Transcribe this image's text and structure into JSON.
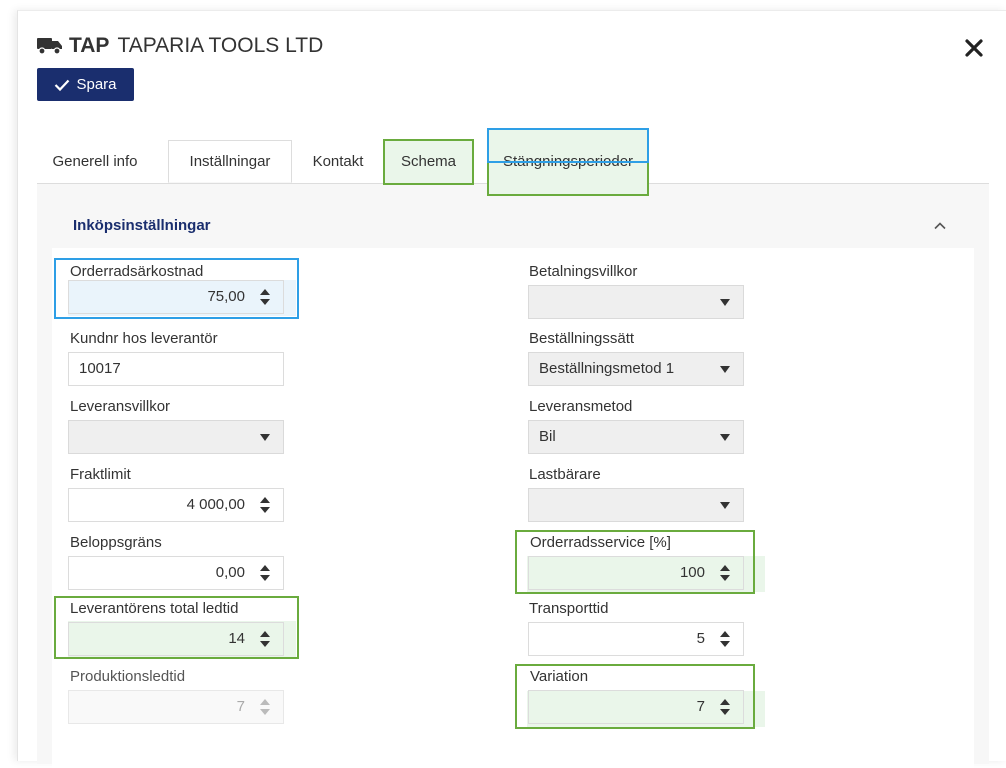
{
  "header": {
    "code": "TAP",
    "name": "TAPARIA TOOLS LTD",
    "save_label": "Spara",
    "truck_icon": "truck-icon",
    "close_icon": "close-icon"
  },
  "tabs": [
    {
      "label": "Generell info"
    },
    {
      "label": "Inställningar"
    },
    {
      "label": "Kontakt"
    },
    {
      "label": "Schema"
    },
    {
      "label": "Stängningsperioder"
    }
  ],
  "section": {
    "title": "Inköpsinställningar"
  },
  "left_fields": {
    "orderradsarkostnad": {
      "label": "Orderradsärkostnad",
      "value": "75,00"
    },
    "kundnr": {
      "label": "Kundnr hos leverantör",
      "value": "10017"
    },
    "leveransvillkor": {
      "label": "Leveransvillkor",
      "value": ""
    },
    "fraktlimit": {
      "label": "Fraktlimit",
      "value": "4 000,00"
    },
    "beloppsgrans": {
      "label": "Beloppsgräns",
      "value": "0,00"
    },
    "total_ledtid": {
      "label": "Leverantörens total ledtid",
      "value": "14"
    },
    "produktionsledtid": {
      "label": "Produktionsledtid",
      "value": "7"
    }
  },
  "right_fields": {
    "betalningsvillkor": {
      "label": "Betalningsvillkor",
      "value": ""
    },
    "bestallningssatt": {
      "label": "Beställningssätt",
      "value": "Beställningsmetod 1"
    },
    "leveransmetod": {
      "label": "Leveransmetod",
      "value": "Bil"
    },
    "lastbarare": {
      "label": "Lastbärare",
      "value": ""
    },
    "orderradsservice": {
      "label": "Orderradsservice [%]",
      "value": "100"
    },
    "transporttid": {
      "label": "Transporttid",
      "value": "5"
    },
    "variation": {
      "label": "Variation",
      "value": "7"
    }
  },
  "colors": {
    "accent": "#1a2e6e",
    "highlight_blue": "#2e9fe6",
    "highlight_green": "#6aab3e"
  }
}
